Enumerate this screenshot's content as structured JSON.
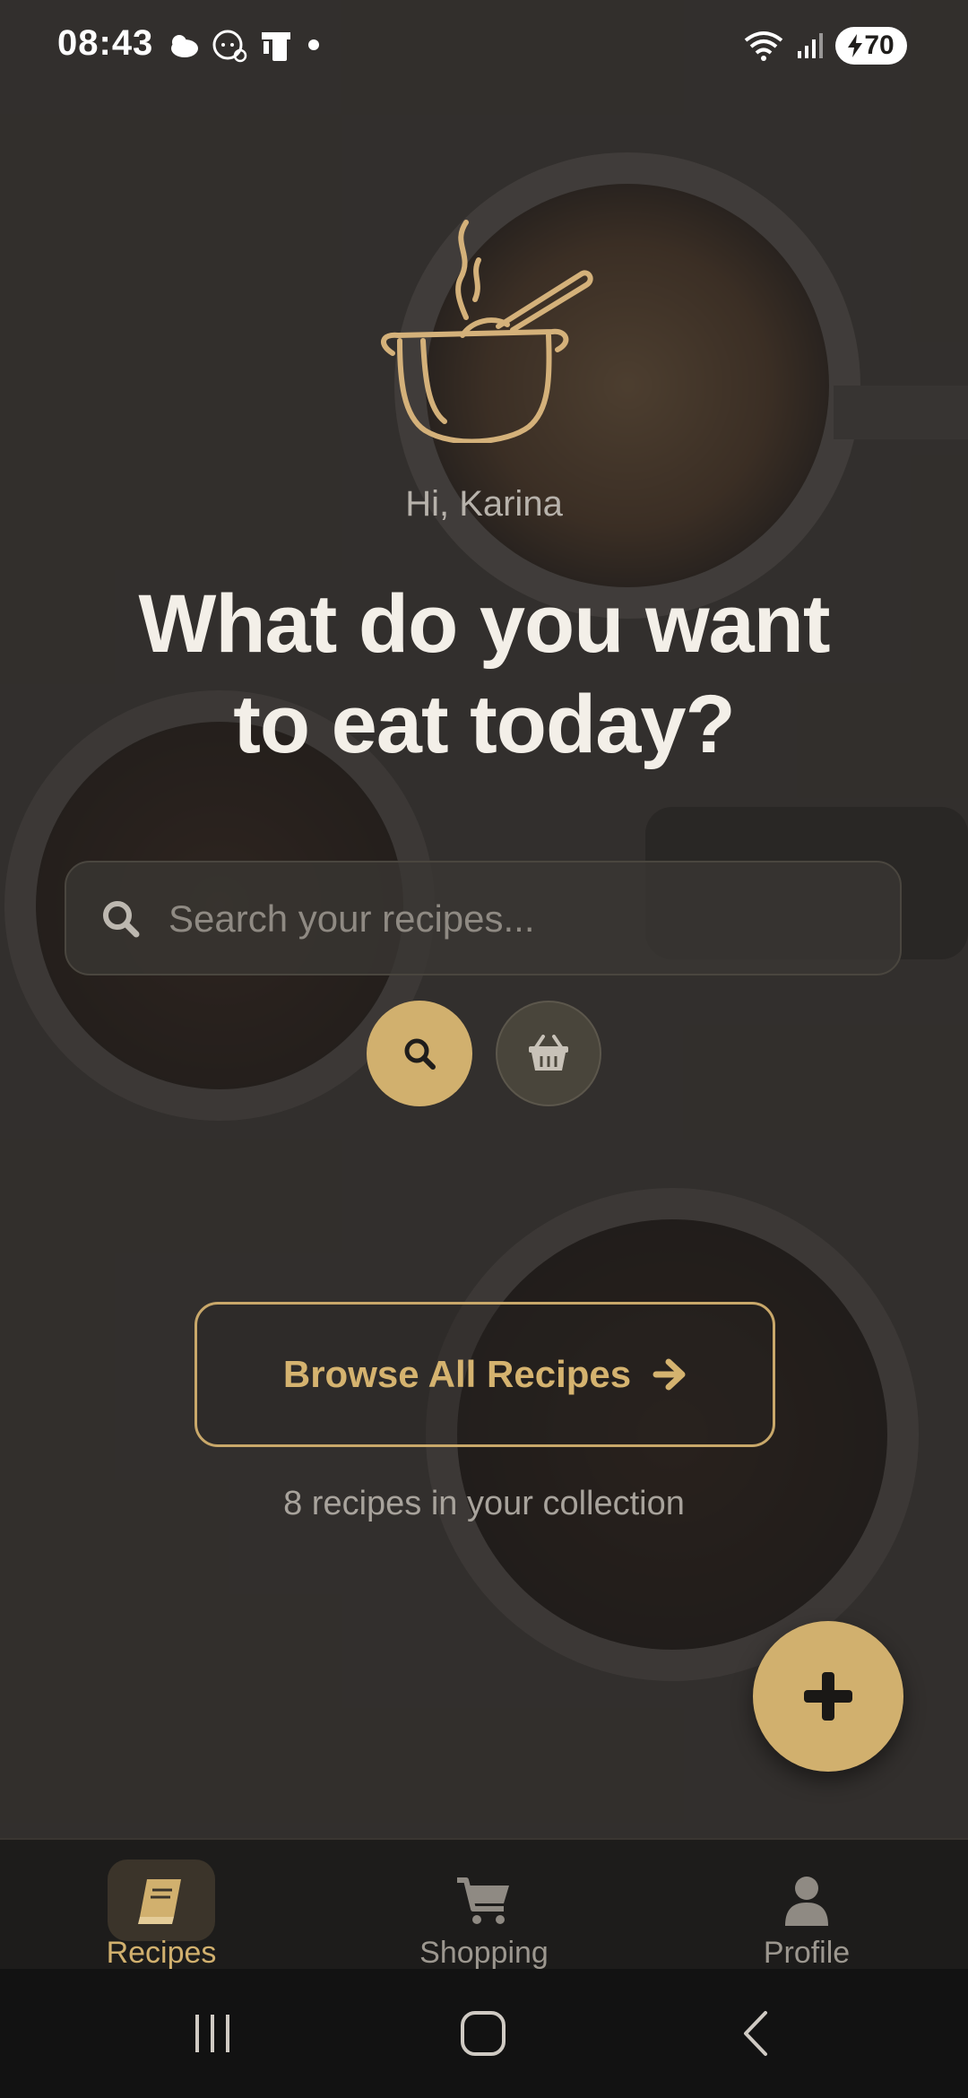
{
  "status_bar": {
    "time": "08:43",
    "battery": "70",
    "left_icons": [
      "weather-icon",
      "baby-face-icon",
      "device-icon",
      "dot-icon"
    ],
    "right_icons": [
      "wifi-icon",
      "signal-icon",
      "battery-icon"
    ]
  },
  "hero": {
    "logo_icon": "cooking-pot-icon",
    "greeting": "Hi, Karina",
    "headline_line1": "What do you want",
    "headline_line2": "to eat today?"
  },
  "search": {
    "placeholder": "Search your recipes...",
    "value": ""
  },
  "actions": {
    "search_button_icon": "search-icon",
    "basket_button_icon": "basket-icon"
  },
  "browse": {
    "label": "Browse All Recipes",
    "icon": "arrow-right-icon",
    "count_text": "8 recipes in your collection"
  },
  "fab": {
    "icon": "plus-icon"
  },
  "bottom_nav": {
    "items": [
      {
        "label": "Recipes",
        "icon": "book-icon",
        "active": true
      },
      {
        "label": "Shopping",
        "icon": "cart-icon",
        "active": false
      },
      {
        "label": "Profile",
        "icon": "person-icon",
        "active": false
      }
    ]
  },
  "system_nav": [
    "recents-icon",
    "home-icon",
    "back-icon"
  ],
  "colors": {
    "accent": "#d1b06e",
    "background": "#2a2826",
    "text_primary": "#f3efe8",
    "text_muted": "#a8a39c"
  }
}
